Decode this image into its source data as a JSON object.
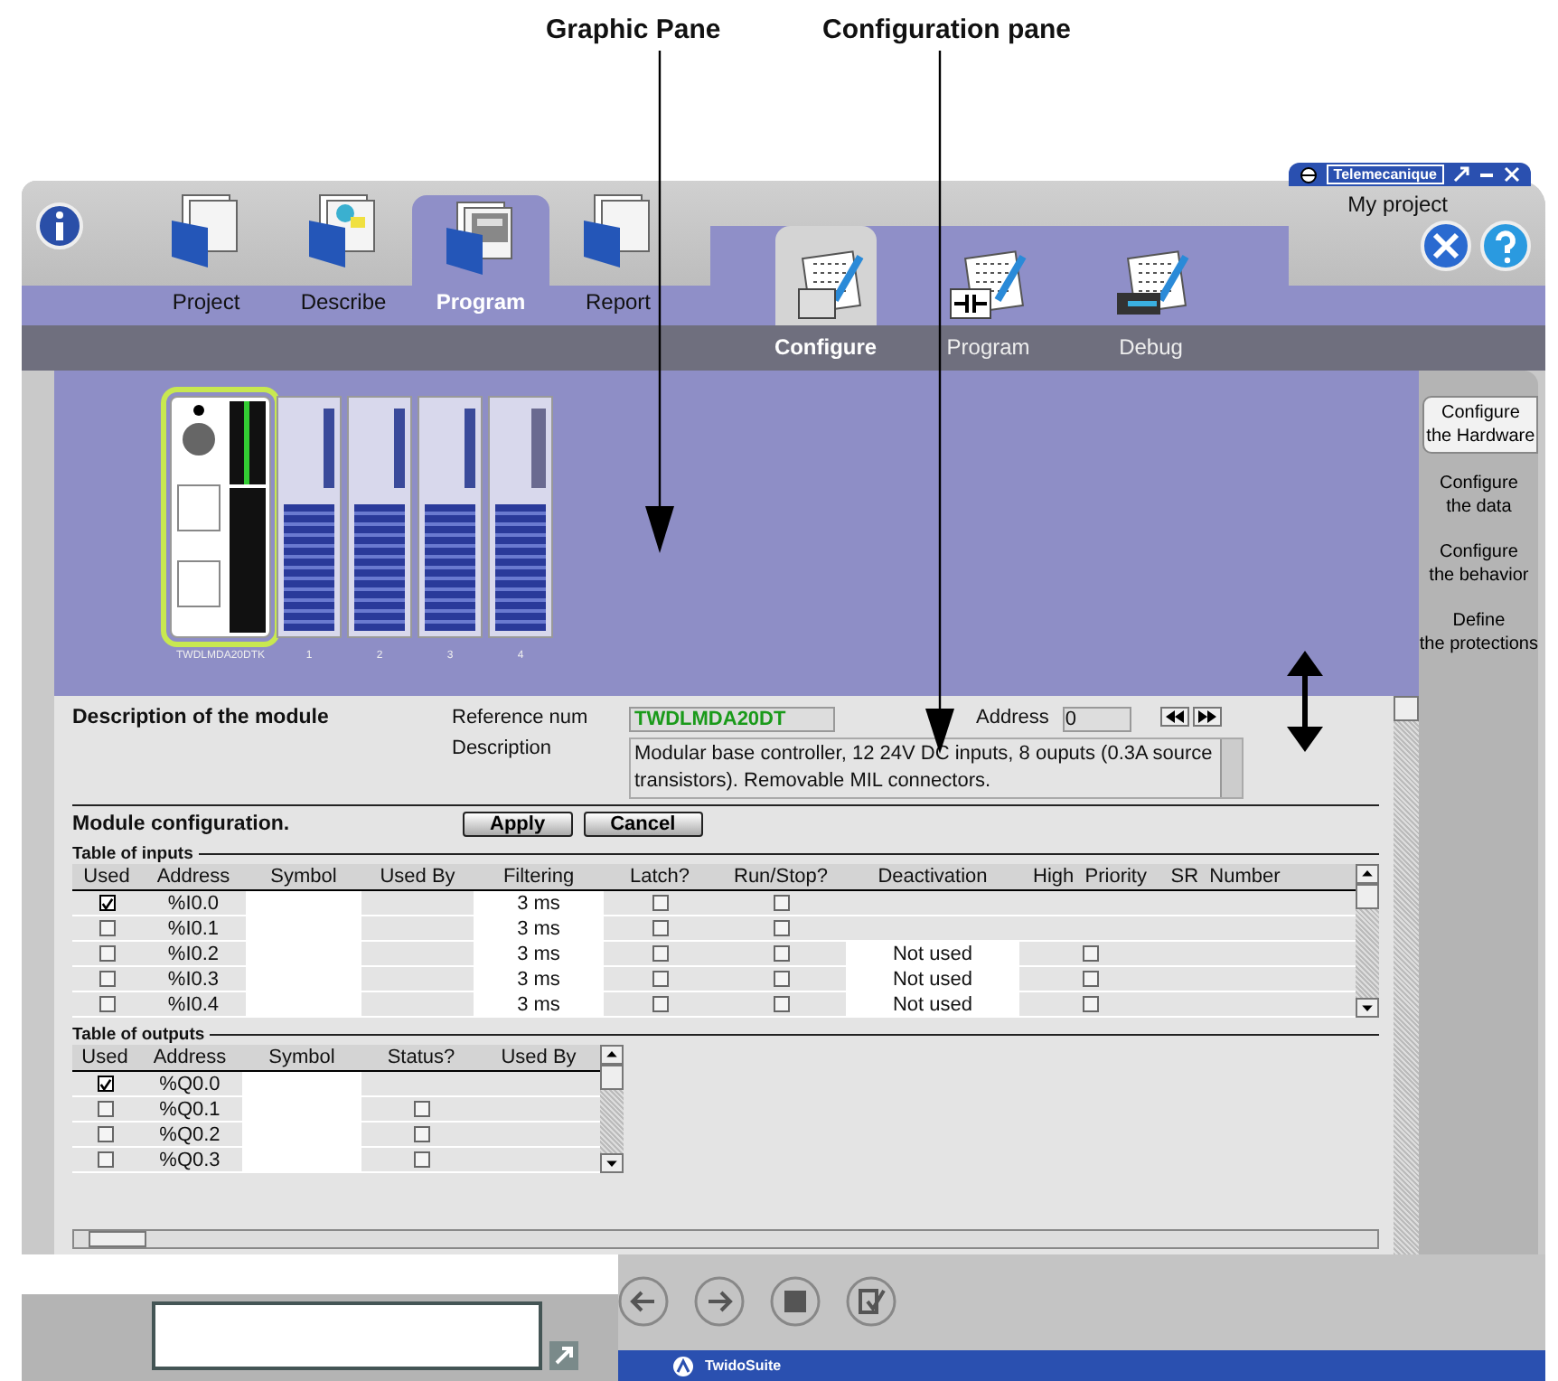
{
  "annotations": [
    {
      "text": "Graphic Pane"
    },
    {
      "text": "Configuration pane"
    }
  ],
  "title_bar": {
    "brand": "Telemecanique",
    "project": "My project"
  },
  "main_tabs": [
    {
      "label": "Project",
      "kind": "project",
      "selected": false
    },
    {
      "label": "Describe",
      "kind": "describe",
      "selected": false
    },
    {
      "label": "Program",
      "kind": "program",
      "selected": true
    },
    {
      "label": "Report",
      "kind": "report",
      "selected": false
    }
  ],
  "sub_tabs": [
    {
      "label": "Configure",
      "kind": "configure",
      "selected": true
    },
    {
      "label": "Program",
      "kind": "ladder",
      "selected": false
    },
    {
      "label": "Debug",
      "kind": "debug",
      "selected": false
    }
  ],
  "modules": [
    {
      "label": "TWDLMDA20DTK",
      "kind": "base",
      "selected": true
    },
    {
      "label": "1",
      "kind": "digital",
      "selected": false
    },
    {
      "label": "2",
      "kind": "digital",
      "selected": false
    },
    {
      "label": "3",
      "kind": "digital",
      "selected": false
    },
    {
      "label": "4",
      "kind": "analog",
      "selected": false
    }
  ],
  "side_tasks": [
    {
      "label": "Configure\nthe Hardware",
      "selected": true
    },
    {
      "label": "Configure\nthe data",
      "selected": false
    },
    {
      "label": "Configure\nthe behavior",
      "selected": false
    },
    {
      "label": "Define\nthe protections",
      "selected": false
    }
  ],
  "description": {
    "heading": "Description of the module",
    "reference_label": "Reference num",
    "reference_value": "TWDLMDA20DT",
    "address_label": "Address",
    "address_value": "0",
    "description_label": "Description",
    "description_value": "Modular base controller, 12 24V DC inputs, 8 ouputs (0.3A source transistors). Removable MIL connectors."
  },
  "module_config": {
    "heading": "Module configuration.",
    "buttons": [
      "Apply",
      "Cancel"
    ]
  },
  "inputs": {
    "title": "Table of inputs",
    "columns": [
      "Used",
      "Address",
      "Symbol",
      "Used By",
      "Filtering",
      "Latch?",
      "Run/Stop?",
      "Deactivation",
      "High  Priority",
      "SR  Number"
    ],
    "rows": [
      {
        "used": true,
        "address": "%I0.0",
        "filtering": "3 ms",
        "latch": false,
        "run_stop": false
      },
      {
        "used": false,
        "address": "%I0.1",
        "filtering": "3 ms",
        "latch": false,
        "run_stop": false
      },
      {
        "used": false,
        "address": "%I0.2",
        "filtering": "3 ms",
        "latch": false,
        "run_stop": false,
        "deactivation": "Not used",
        "high_priority": false
      },
      {
        "used": false,
        "address": "%I0.3",
        "filtering": "3 ms",
        "latch": false,
        "run_stop": false,
        "deactivation": "Not used",
        "high_priority": false
      },
      {
        "used": false,
        "address": "%I0.4",
        "filtering": "3 ms",
        "latch": false,
        "run_stop": false,
        "deactivation": "Not used",
        "high_priority": false
      }
    ]
  },
  "outputs": {
    "title": "Table of outputs",
    "columns": [
      "Used",
      "Address",
      "Symbol",
      "Status?",
      "Used By"
    ],
    "rows": [
      {
        "used": true,
        "address": "%Q0.0"
      },
      {
        "used": false,
        "address": "%Q0.1",
        "status": false
      },
      {
        "used": false,
        "address": "%Q0.2",
        "status": false
      },
      {
        "used": false,
        "address": "%Q0.3",
        "status": false
      }
    ]
  },
  "footer": {
    "app_name": "TwidoSuite"
  }
}
